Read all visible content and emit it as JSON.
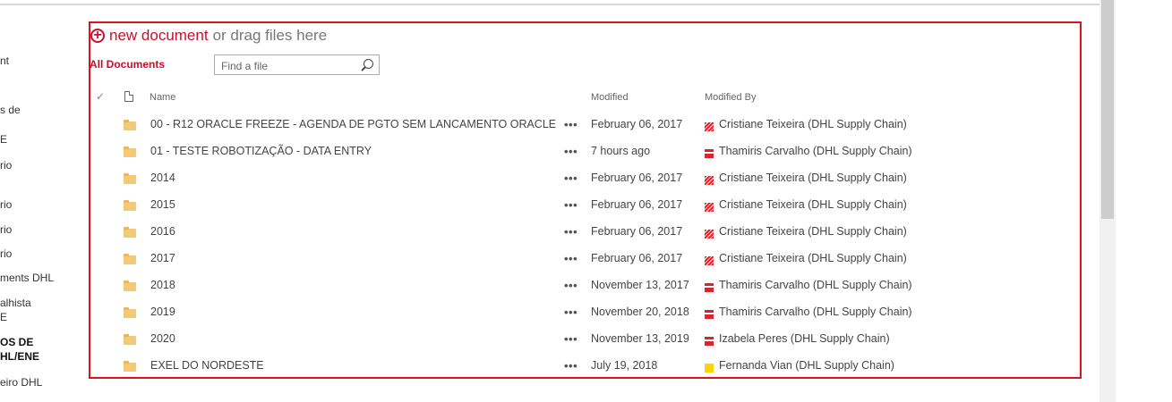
{
  "left_nav": {
    "items": [
      {
        "label": "nt",
        "bold": false
      },
      {
        "label": "s de",
        "bold": false
      },
      {
        "label": "E",
        "bold": false
      },
      {
        "label": "rio",
        "bold": false
      },
      {
        "label": "rio",
        "bold": false
      },
      {
        "label": "rio",
        "bold": false
      },
      {
        "label": "rio",
        "bold": false
      },
      {
        "label": "ments DHL",
        "bold": false
      },
      {
        "label": "alhista",
        "bold": false
      },
      {
        "label": "E",
        "bold": false
      },
      {
        "label": "OS DE",
        "bold": true
      },
      {
        "label": "HL/ENE",
        "bold": true
      },
      {
        "label": "eiro DHL",
        "bold": false
      }
    ]
  },
  "toolbar": {
    "new_document_label": "new document",
    "drag_text": "or drag files here",
    "view_label": "All Documents",
    "search_placeholder": "Find a file"
  },
  "columns": {
    "name": "Name",
    "modified": "Modified",
    "modified_by": "Modified By"
  },
  "rows": [
    {
      "name": "00 - R12 ORACLE FREEZE - AGENDA DE PGTO SEM LANCAMENTO ORACLE",
      "modified": "February 06, 2017",
      "modified_by": "Cristiane Teixeira (DHL Supply Chain)",
      "presence": "busy"
    },
    {
      "name": "01 - TESTE ROBOTIZAÇÃO - DATA ENTRY",
      "modified": "7 hours ago",
      "modified_by": "Thamiris Carvalho (DHL Supply Chain)",
      "presence": "dnd"
    },
    {
      "name": "2014",
      "modified": "February 06, 2017",
      "modified_by": "Cristiane Teixeira (DHL Supply Chain)",
      "presence": "busy"
    },
    {
      "name": "2015",
      "modified": "February 06, 2017",
      "modified_by": "Cristiane Teixeira (DHL Supply Chain)",
      "presence": "busy"
    },
    {
      "name": "2016",
      "modified": "February 06, 2017",
      "modified_by": "Cristiane Teixeira (DHL Supply Chain)",
      "presence": "busy"
    },
    {
      "name": "2017",
      "modified": "February 06, 2017",
      "modified_by": "Cristiane Teixeira (DHL Supply Chain)",
      "presence": "busy"
    },
    {
      "name": "2018",
      "modified": "November 13, 2017",
      "modified_by": "Thamiris Carvalho (DHL Supply Chain)",
      "presence": "dnd"
    },
    {
      "name": "2019",
      "modified": "November 20, 2018",
      "modified_by": "Thamiris Carvalho (DHL Supply Chain)",
      "presence": "dnd"
    },
    {
      "name": "2020",
      "modified": "November 13, 2019",
      "modified_by": "Izabela Peres (DHL Supply Chain)",
      "presence": "dnd"
    },
    {
      "name": "EXEL DO NORDESTE",
      "modified": "July 19, 2018",
      "modified_by": "Fernanda Vian (DHL Supply Chain)",
      "presence": "away"
    }
  ],
  "colors": {
    "accent": "#c8102e",
    "frame": "#e0101a",
    "folder": "#f2c978",
    "presence_busy": "#d9262e",
    "presence_away": "#ffd200"
  }
}
